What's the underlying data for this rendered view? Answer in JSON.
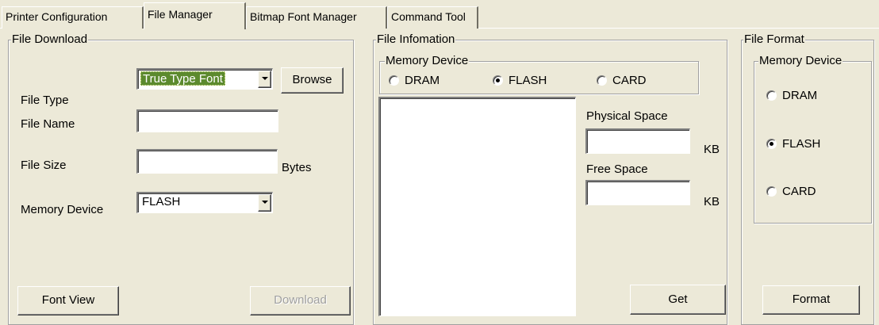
{
  "tabs": [
    {
      "label": "Printer Configuration",
      "active": false
    },
    {
      "label": "File Manager",
      "active": true
    },
    {
      "label": "Bitmap Font Manager",
      "active": false
    },
    {
      "label": "Command Tool",
      "active": false
    }
  ],
  "file_download": {
    "legend": "File Download",
    "file_type_label": "File Type",
    "file_type_value": "True Type Font",
    "browse_label": "Browse",
    "file_name_label": "File Name",
    "file_name_value": "",
    "file_size_label": "File Size",
    "file_size_value": "",
    "bytes_label": "Bytes",
    "memory_device_label": "Memory Device",
    "memory_device_value": "FLASH",
    "font_view_label": "Font View",
    "download_label": "Download"
  },
  "file_information": {
    "legend": "File Infomation",
    "memory_device_legend": "Memory Device",
    "radios": [
      {
        "label": "DRAM",
        "checked": false
      },
      {
        "label": "FLASH",
        "checked": true
      },
      {
        "label": "CARD",
        "checked": false
      }
    ],
    "physical_space_label": "Physical Space",
    "physical_space_value": "",
    "physical_space_unit": "KB",
    "free_space_label": "Free Space",
    "free_space_value": "",
    "free_space_unit": "KB",
    "get_label": "Get"
  },
  "file_format": {
    "legend": "File Format",
    "memory_device_legend": "Memory Device",
    "radios": [
      {
        "label": "DRAM",
        "checked": false
      },
      {
        "label": "FLASH",
        "checked": true
      },
      {
        "label": "CARD",
        "checked": false
      }
    ],
    "format_label": "Format"
  },
  "colors": {
    "face": "#ECE9D8",
    "selection": "#5C8A2E"
  }
}
